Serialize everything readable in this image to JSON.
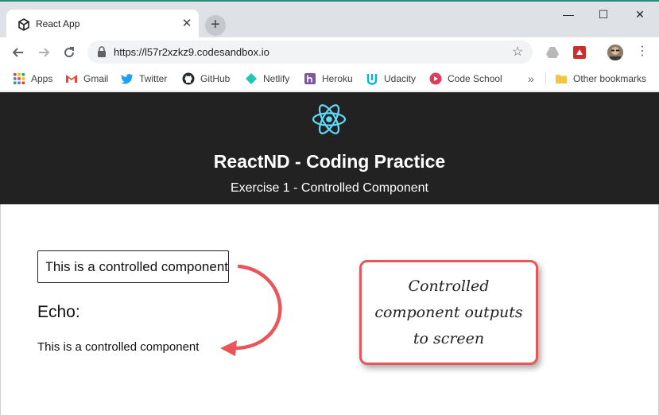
{
  "browser": {
    "tab": {
      "title": "React App"
    },
    "address": {
      "url": "https://l57r2xzkz9.codesandbox.io"
    },
    "bookmarks": [
      {
        "label": "Apps",
        "icon": "apps-grid-icon",
        "color": "#4285f4"
      },
      {
        "label": "Gmail",
        "icon": "gmail-icon",
        "color": "#ea4335"
      },
      {
        "label": "Twitter",
        "icon": "twitter-icon",
        "color": "#1da1f2"
      },
      {
        "label": "GitHub",
        "icon": "github-icon",
        "color": "#24292e"
      },
      {
        "label": "Netlify",
        "icon": "netlify-icon",
        "color": "#20c6b7"
      },
      {
        "label": "Heroku",
        "icon": "heroku-icon",
        "color": "#79589f"
      },
      {
        "label": "Udacity",
        "icon": "udacity-icon",
        "color": "#02b3e4"
      },
      {
        "label": "Code School",
        "icon": "code-school-icon",
        "color": "#e03c5a"
      }
    ],
    "other_bookmarks": "Other bookmarks"
  },
  "app": {
    "title": "ReactND - Coding Practice",
    "subtitle": "Exercise 1 - Controlled Component",
    "input_value": "This is a controlled component",
    "echo_label": "Echo:",
    "echo_value": "This is a controlled component"
  },
  "annotation": {
    "lines": [
      "Controlled",
      "component outputs",
      "to screen"
    ]
  },
  "colors": {
    "header_bg": "#222222",
    "react_blue": "#61dafb",
    "callout_border": "#e8555a",
    "arrow": "#e8555a"
  }
}
